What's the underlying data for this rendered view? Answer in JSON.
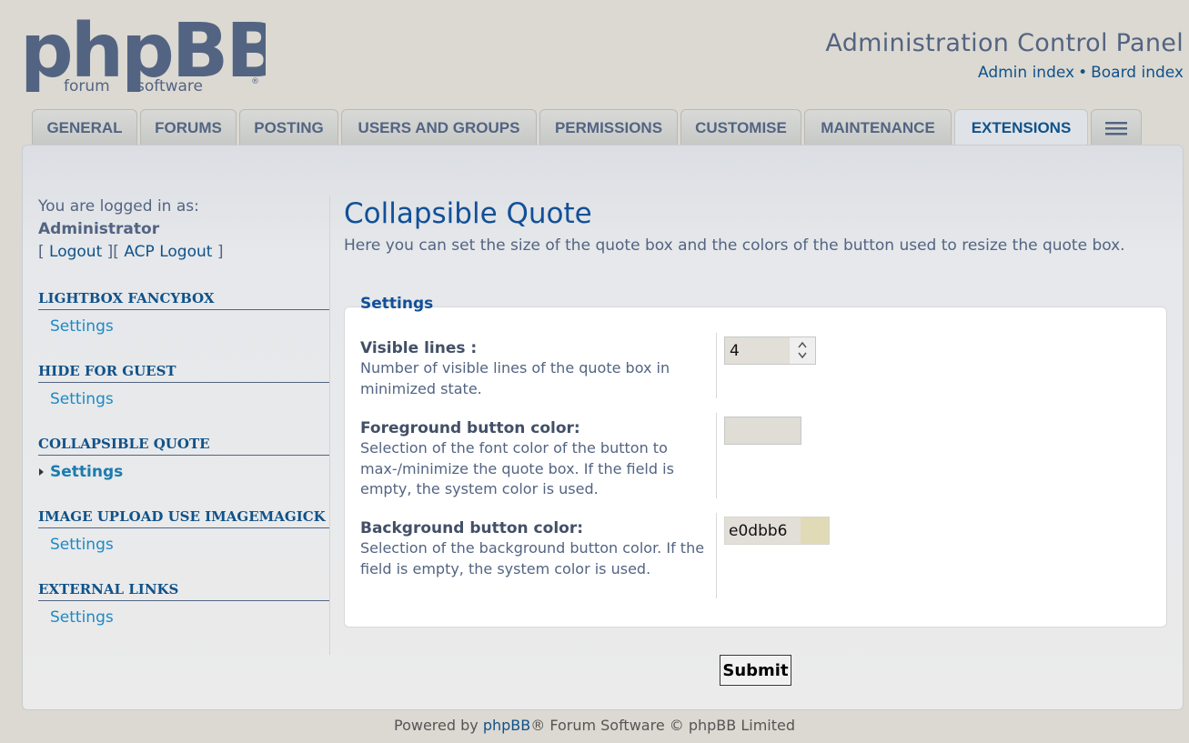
{
  "header": {
    "logo_text": "phpBB",
    "logo_sub_left": "forum",
    "logo_sub_right": "software",
    "title": "Administration Control Panel",
    "links": [
      {
        "label": "Admin index"
      },
      {
        "label": "Board index"
      }
    ],
    "link_separator": "•"
  },
  "tabs": [
    {
      "label": "GENERAL",
      "active": false
    },
    {
      "label": "FORUMS",
      "active": false
    },
    {
      "label": "POSTING",
      "active": false
    },
    {
      "label": "USERS AND GROUPS",
      "active": false
    },
    {
      "label": "PERMISSIONS",
      "active": false
    },
    {
      "label": "CUSTOMISE",
      "active": false
    },
    {
      "label": "MAINTENANCE",
      "active": false
    },
    {
      "label": "EXTENSIONS",
      "active": true
    }
  ],
  "sidebar": {
    "logged_in_text": "You are logged in as:",
    "username": "Administrator",
    "logout": "Logout",
    "acp_logout": "ACP Logout",
    "bracket_open": "[",
    "bracket_mid": "][",
    "bracket_close": "]",
    "sections": [
      {
        "title": "LIGHTBOX FANCYBOX",
        "item": "Settings",
        "active": false
      },
      {
        "title": "HIDE FOR GUEST",
        "item": "Settings",
        "active": false
      },
      {
        "title": "COLLAPSIBLE QUOTE",
        "item": "Settings",
        "active": true
      },
      {
        "title": "IMAGE UPLOAD USE IMAGEMAGICK",
        "item": "Settings",
        "active": false
      },
      {
        "title": "EXTERNAL LINKS",
        "item": "Settings",
        "active": false
      }
    ]
  },
  "main": {
    "title": "Collapsible Quote",
    "description": "Here you can set the size of the quote box and the colors of the button used to resize the quote box.",
    "legend": "Settings",
    "fields": [
      {
        "label": "Visible lines :",
        "description": "Number of visible lines of the quote box in minimized state.",
        "value": "4"
      },
      {
        "label": "Foreground button color:",
        "description": "Selection of the font color of the button to max-/minimize the quote box. If the field is empty, the system color is used.",
        "value": ""
      },
      {
        "label": "Background button color:",
        "description": "Selection of the background button color. If the field is empty, the system color is used.",
        "value": "e0dbb6",
        "swatch_color": "#e0dbb6"
      }
    ],
    "submit_label": "Submit"
  },
  "footer": {
    "prefix": "Powered by",
    "link": "phpBB",
    "suffix": "® Forum Software © phpBB Limited"
  },
  "colors": {
    "page_bg": "#dcd9d2",
    "link": "#105289",
    "accent": "#115098",
    "text": "#536482"
  }
}
